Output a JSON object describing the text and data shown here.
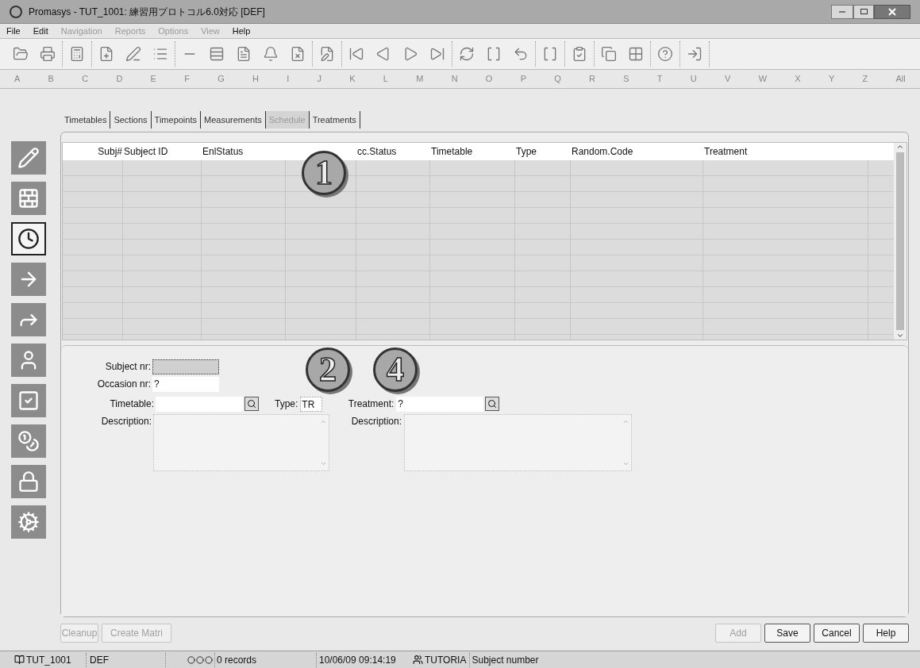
{
  "window": {
    "title": "Promasys - TUT_1001: 練習用プロトコル6.0対応 [DEF]"
  },
  "menu": [
    {
      "label": "File",
      "disabled": false
    },
    {
      "label": "Edit",
      "disabled": false
    },
    {
      "label": "Navigation",
      "disabled": true
    },
    {
      "label": "Reports",
      "disabled": true
    },
    {
      "label": "Options",
      "disabled": true
    },
    {
      "label": "View",
      "disabled": true
    },
    {
      "label": "Help",
      "disabled": false
    }
  ],
  "letters": [
    "A",
    "B",
    "C",
    "D",
    "E",
    "F",
    "G",
    "H",
    "I",
    "J",
    "K",
    "L",
    "M",
    "N",
    "O",
    "P",
    "Q",
    "R",
    "S",
    "T",
    "U",
    "V",
    "W",
    "X",
    "Y",
    "Z",
    "All"
  ],
  "tabs": [
    {
      "label": "Timetables",
      "selected": false
    },
    {
      "label": "Sections",
      "selected": false
    },
    {
      "label": "Timepoints",
      "selected": false
    },
    {
      "label": "Measurements",
      "selected": false
    },
    {
      "label": "Schedule",
      "selected": true
    },
    {
      "label": "Treatments",
      "selected": false
    }
  ],
  "sidebar": [
    {
      "kind": "pencil",
      "selected": false
    },
    {
      "kind": "trowel",
      "selected": false
    },
    {
      "kind": "clock",
      "selected": true
    },
    {
      "kind": "arrow",
      "selected": false
    },
    {
      "kind": "double-arrow",
      "selected": false
    },
    {
      "kind": "person",
      "selected": false
    },
    {
      "kind": "check",
      "selected": false
    },
    {
      "kind": "coins",
      "selected": false
    },
    {
      "kind": "lock",
      "selected": false
    },
    {
      "kind": "gear",
      "selected": false
    }
  ],
  "grid": {
    "columns": [
      {
        "kind": "text",
        "label": "Subj#"
      },
      {
        "kind": "text",
        "label": "Subject ID"
      },
      {
        "kind": "text",
        "label": "EnlStatus"
      },
      {
        "kind": "blank"
      },
      {
        "kind": "text",
        "label": "cc.Status"
      },
      {
        "kind": "text",
        "label": "Timetable"
      },
      {
        "kind": "text",
        "label": "Type"
      },
      {
        "kind": "text",
        "label": "Random.Code"
      },
      {
        "kind": "text",
        "label": "Treatment"
      }
    ]
  },
  "callouts": [
    "1",
    "2",
    "4"
  ],
  "form": {
    "subject_nr": {
      "label": "Subject nr:"
    },
    "occasion_nr": {
      "label": "Occasion nr:",
      "value": "?"
    },
    "timetable": {
      "label": "Timetable:"
    },
    "type": {
      "label": "Type:",
      "value": "TR"
    },
    "treatment": {
      "label": "Treatment:",
      "value": "?"
    },
    "description_left": {
      "label": "Description:"
    },
    "description_right": {
      "label": "Description:"
    }
  },
  "buttons_left": [
    {
      "label": "Cleanup",
      "disabled": true
    },
    {
      "label": "Create Matri",
      "disabled": true
    }
  ],
  "buttons_right": [
    {
      "label": "Add",
      "disabled": true
    },
    {
      "label": "Save",
      "disabled": false
    },
    {
      "label": "Cancel",
      "disabled": false
    },
    {
      "label": "Help",
      "disabled": false
    }
  ],
  "status_bar": {
    "protocol": "TUT_1001",
    "site": "DEF",
    "records": "0 records",
    "datetime": "10/06/09 09:14:19",
    "user": "TUTORIA",
    "message": "Subject number"
  }
}
